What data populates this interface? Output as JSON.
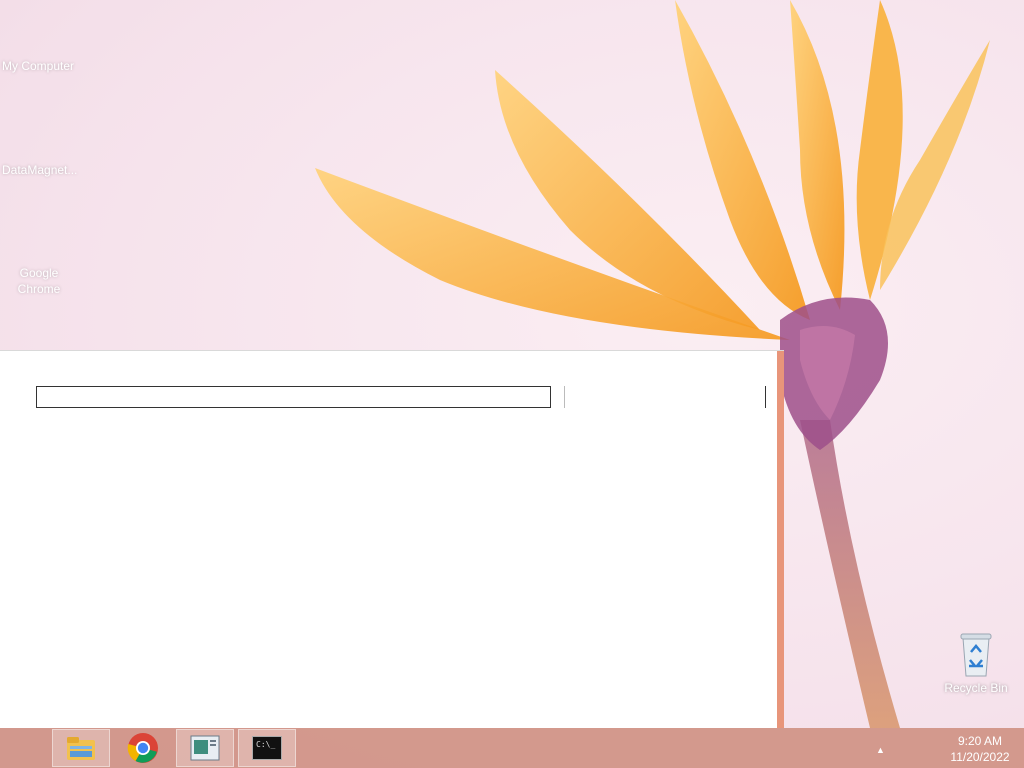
{
  "desktop": {
    "icons": [
      {
        "label": "My Computer"
      },
      {
        "label": "DataMagnet..."
      },
      {
        "label": "Google Chrome"
      }
    ],
    "recycle_bin": {
      "label": "Recycle Bin"
    }
  },
  "window": {
    "input_value": "",
    "side_value": ""
  },
  "taskbar": {
    "buttons": [
      {
        "name": "File Explorer",
        "icon": "folder-icon"
      },
      {
        "name": "Google Chrome",
        "icon": "chrome-icon"
      },
      {
        "name": "Application window",
        "icon": "app-window-icon"
      },
      {
        "name": "Command Prompt",
        "icon": "cmd-icon",
        "icon_text": "C:\\_"
      }
    ],
    "clock": {
      "time": "9:20 AM",
      "date": "11/20/2022"
    },
    "tray_arrow": "▲"
  },
  "colors": {
    "taskbar": "#cd8c7d",
    "window_frame": "#e8957a",
    "petal": "#f6b13a"
  }
}
